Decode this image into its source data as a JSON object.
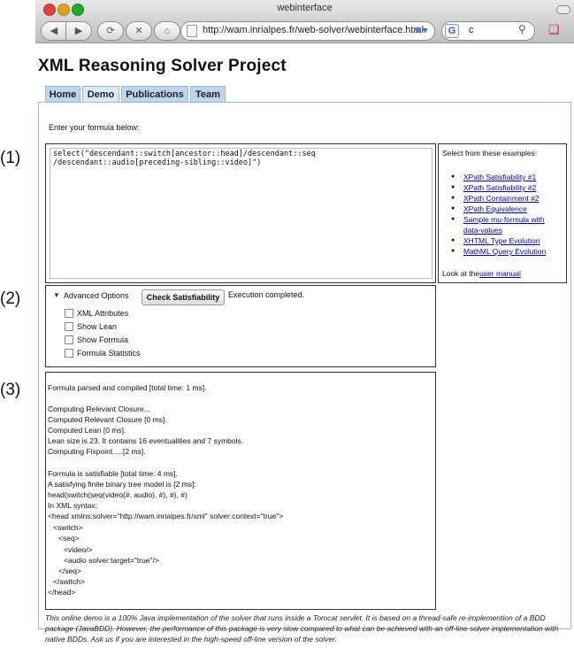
{
  "window": {
    "title": "webinterface",
    "url": "http://wam.inrialpes.fr/web-solver/webinterface.html",
    "search_text": "c",
    "search_engine_icon": "G"
  },
  "page": {
    "title": "XML Reasoning Solver Project",
    "tabs": [
      "Home",
      "Demo",
      "Publications",
      "Team"
    ],
    "active_tab": "Demo",
    "intro": "Enter your formula below:",
    "markers": [
      "(1)",
      "(2)",
      "(3)"
    ],
    "formula": "select(\"descendant::switch[ancestor::head]/descendant::seq\n/descendant::audio[preceding-sibling::video]\")",
    "examples": {
      "heading": "Select from these examples:",
      "items": [
        "XPath Satisfiability #1",
        "XPath Satisfiability #2",
        "XPath Containment #2",
        "XPath Equivalence",
        "Sample mu-formula with data-values",
        "XHTML Type Evolution",
        "MathML Query Evolution"
      ],
      "manual_prefix": "Look at the ",
      "manual_link": "user manual"
    },
    "options": {
      "advanced_label": "Advanced Options",
      "check_button": "Check Satisfiability",
      "status": "Execution completed.",
      "checkboxes": [
        "XML Attributes",
        "Show Lean",
        "Show Formula",
        "Formula Statistics"
      ]
    },
    "output": [
      "Formula parsed and compiled [total time: 1 ms].",
      "",
      "Computing Relevant Closure...",
      "Computed Relevant Closure [0 ms].",
      "Computed Lean [0 ms].",
      "Lean size is 23. It contains 16 eventualities and 7 symbols.",
      "Computing Fixpoint.....[2 ms].",
      "",
      "Formula is satisfiable [total time: 4 ms].",
      "A satisfying finite binary tree model is [2 ms]:",
      "head(switch(seq(video(#, audio), #), #), #)",
      "In XML syntax:",
      "<head xmlns:solver=\"http://wam.inrialpes.fr/xml\" solver:context=\"true\">",
      "  <switch>",
      "    <seq>",
      "      <video/>",
      "      <audio solver:target=\"true\"/>",
      "    </seq>",
      "  </switch>",
      "</head>"
    ],
    "footer": "This online demo is a 100% Java implementation of the solver that runs inside a Tomcat servlet. It is based on a thread-safe re-implemention of a BDD package (JavaBDD). However, the performance of this package is very slow compared to what can be achieved with an off-line solver implementation with native BDDs. Ask us if you are interested in the high-speed off-line version of the solver."
  }
}
